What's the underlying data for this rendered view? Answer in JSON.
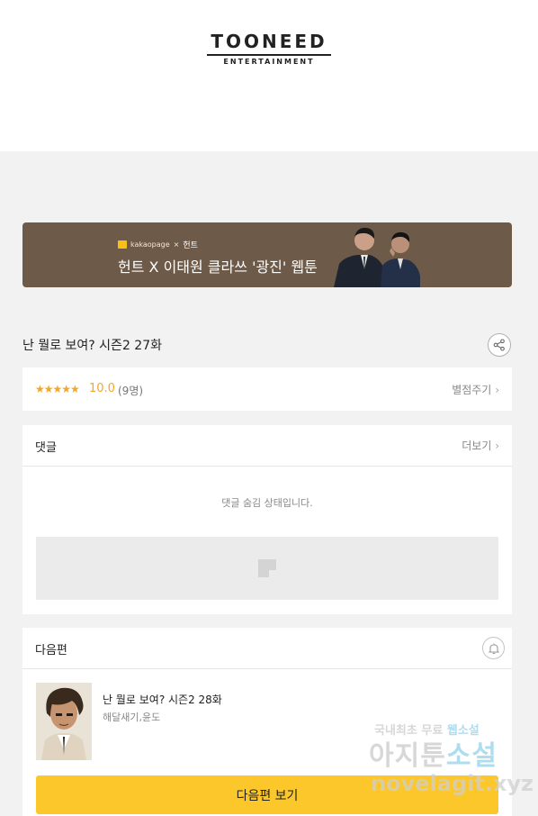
{
  "logo": {
    "main": "TOONEED",
    "sub": "ENTERTAINMENT"
  },
  "banner": {
    "brand": "kakaopage",
    "brand_sep": "×",
    "brand_partner": "헌트",
    "title": "헌트 X 이태원 클라쓰 '광진' 웹툰",
    "bg_color": "#6e5a48"
  },
  "episode": {
    "title": "난 뭘로 보여? 시즌2 27화",
    "share_icon": "share-icon"
  },
  "rating": {
    "stars": "★★★★★",
    "score": "10.0",
    "count": "(9명)",
    "rate_link": "별점주기",
    "star_color": "#f5a623"
  },
  "comments": {
    "label": "댓글",
    "more": "더보기",
    "hidden_message": "댓글 숨김 상태입니다."
  },
  "next": {
    "label": "다음편",
    "bell_icon": "bell-icon",
    "title": "난 뭘로 보여? 시즌2 28화",
    "author": "해달새기,윤도",
    "button": "다음편 보기",
    "button_color": "#fcc72a"
  },
  "watermark": {
    "line1_a": "국내최초 무료",
    "line1_b": "웹소설",
    "line2_a": "아지툰",
    "line2_b": "소설",
    "line3": "novelagit.xyz"
  }
}
